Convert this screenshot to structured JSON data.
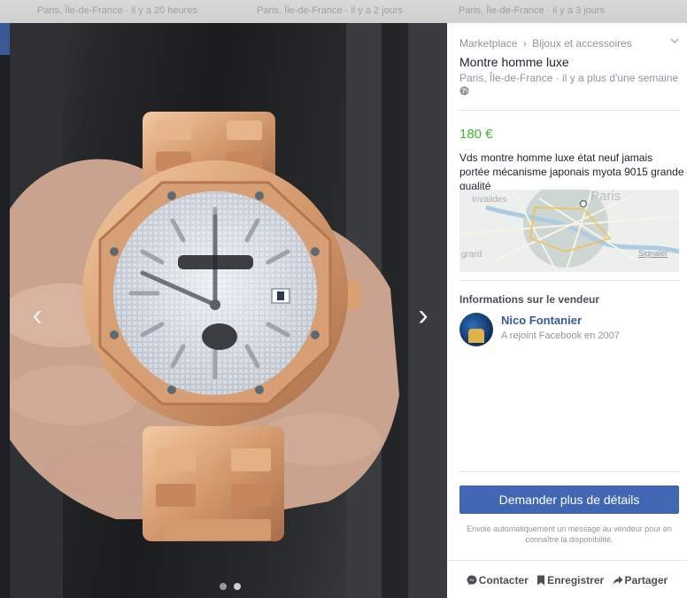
{
  "colors": {
    "price_green": "#42b72a",
    "button_blue": "#4267b2",
    "link_blue": "#365899",
    "muted_gray": "#90949c"
  },
  "background": {
    "ghost_texts": [
      "Paris, Île-de-France · il y a 20 heures",
      "Paris, Île-de-France · il y a 2 jours",
      "Paris, Île-de-France · il y a 3 jours"
    ]
  },
  "listing": {
    "breadcrumb": [
      "Marketplace",
      "Bijoux et accessoires"
    ],
    "breadcrumb_separator": "›",
    "title": "Montre homme luxe",
    "meta": "Paris, Île-de-France · il y a plus d'une semaine ·",
    "price": "180 €",
    "description": "Vds montre homme luxe état neuf jamais portée mécanisme japonais myota 9015 grande qualité",
    "photo_count": 2,
    "active_photo_index": 0
  },
  "map": {
    "labels": [
      "Invalides",
      "Paris",
      "grard"
    ],
    "report_link": "Signaler"
  },
  "seller": {
    "heading": "Informations sur le vendeur",
    "name": "Nico Fontanier",
    "joined": "A rejoint Facebook en 2007"
  },
  "cta": {
    "button_label": "Demander plus de détails",
    "note": "Envoie automatiquement un message au vendeur pour en connaître la disponibilité."
  },
  "actions": [
    {
      "label": "Contacter",
      "icon": "messenger-icon"
    },
    {
      "label": "Enregistrer",
      "icon": "bookmark-icon"
    },
    {
      "label": "Partager",
      "icon": "share-arrow-icon"
    }
  ]
}
